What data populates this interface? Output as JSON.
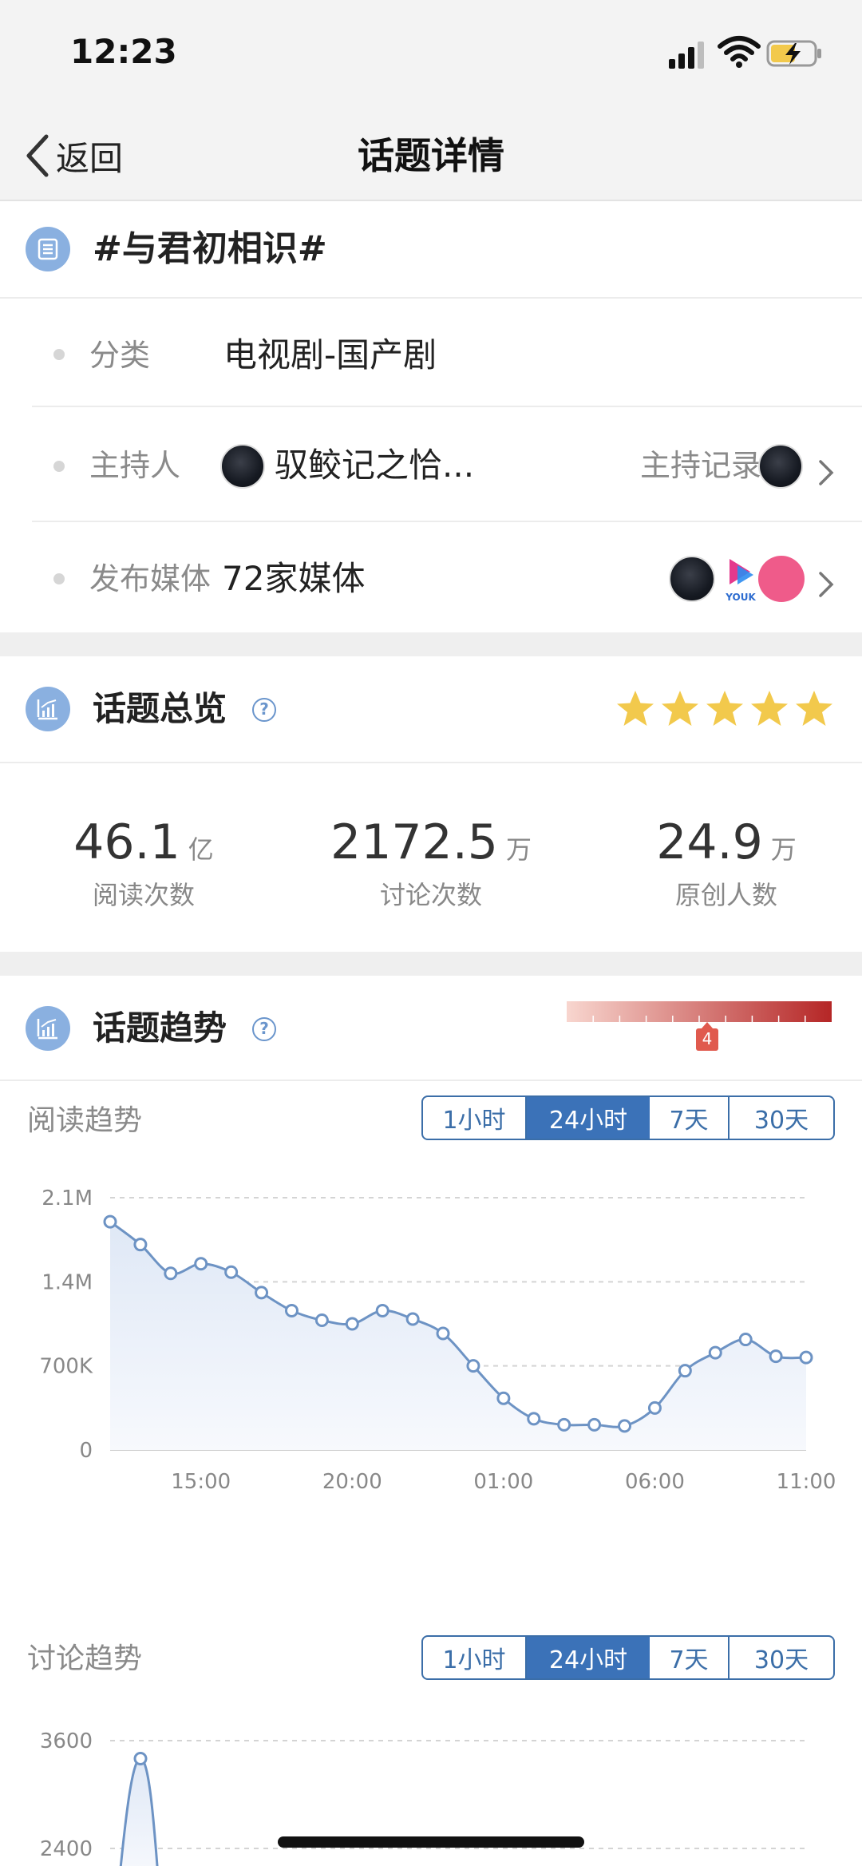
{
  "status": {
    "time": "12:23"
  },
  "nav": {
    "back_label": "返回",
    "title": "话题详情"
  },
  "topic": {
    "name": "#与君初相识#",
    "rows": [
      {
        "label": "分类",
        "value": "电视剧-国产剧"
      },
      {
        "label": "主持人",
        "value": "驭鲛记之恰...",
        "right_label": "主持记录"
      },
      {
        "label": "发布媒体",
        "value": "72家媒体"
      }
    ]
  },
  "overview": {
    "title": "话题总览",
    "stars": 5,
    "stats": [
      {
        "value": "46.1",
        "unit": "亿",
        "label": "阅读次数"
      },
      {
        "value": "2172.5",
        "unit": "万",
        "label": "讨论次数"
      },
      {
        "value": "24.9",
        "unit": "万",
        "label": "原创人数"
      }
    ]
  },
  "trend": {
    "title": "话题趋势",
    "heat_level": "4",
    "heat_level_fraction": 0.5,
    "read_title": "阅读趋势",
    "discuss_title": "讨论趋势",
    "tabs": [
      "1小时",
      "24小时",
      "7天",
      "30天"
    ],
    "active_tab": "24小时"
  },
  "colors": {
    "accent": "#3b72b8",
    "line": "#6d93c4",
    "star": "#f2c94c",
    "heat_end": "#b52626"
  },
  "chart_data": [
    {
      "type": "area",
      "title": "阅读趋势",
      "x_ticks": [
        "15:00",
        "20:00",
        "01:00",
        "06:00",
        "11:00"
      ],
      "y_ticks": [
        "0",
        "700K",
        "1.4M",
        "2.1M"
      ],
      "ylim": [
        0,
        2100000
      ],
      "grid": true,
      "series": [
        {
          "values": [
            1900000,
            1710000,
            1470000,
            1550000,
            1480000,
            1310000,
            1160000,
            1080000,
            1050000,
            1160000,
            1090000,
            970000,
            700000,
            430000,
            260000,
            210000,
            210000,
            200000,
            350000,
            660000,
            810000,
            920000,
            780000,
            770000
          ]
        }
      ]
    },
    {
      "type": "area",
      "title": "讨论趋势",
      "y_ticks": [
        "2400",
        "3600"
      ],
      "grid": true,
      "series": [
        {
          "values": [
            0,
            3400,
            0
          ]
        }
      ]
    }
  ]
}
